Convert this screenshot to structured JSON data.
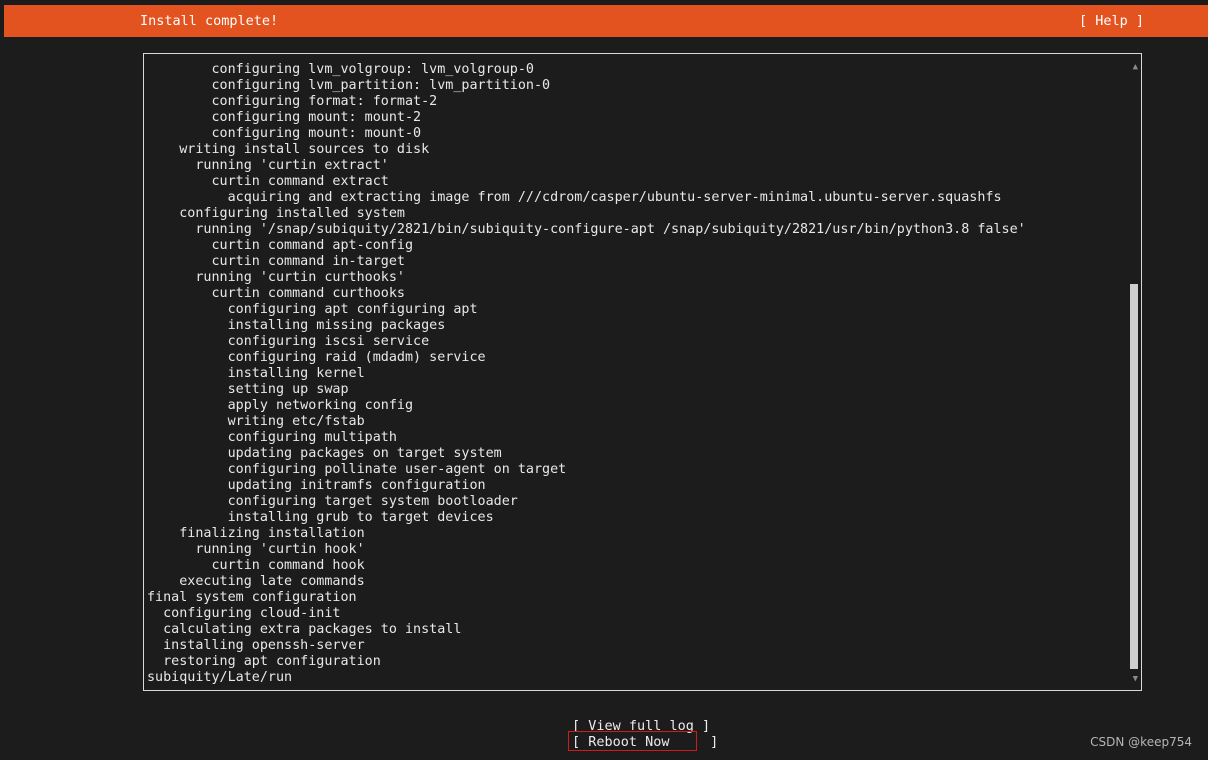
{
  "header": {
    "title": "Install complete!",
    "help_label": "[ Help ]",
    "color": "#e2531f"
  },
  "log": {
    "lines": [
      "        configuring lvm_volgroup: lvm_volgroup-0",
      "        configuring lvm_partition: lvm_partition-0",
      "        configuring format: format-2",
      "        configuring mount: mount-2",
      "        configuring mount: mount-0",
      "    writing install sources to disk",
      "      running 'curtin extract'",
      "        curtin command extract",
      "          acquiring and extracting image from ///cdrom/casper/ubuntu-server-minimal.ubuntu-server.squashfs",
      "    configuring installed system",
      "      running '/snap/subiquity/2821/bin/subiquity-configure-apt /snap/subiquity/2821/usr/bin/python3.8 false'",
      "        curtin command apt-config",
      "        curtin command in-target",
      "      running 'curtin curthooks'",
      "        curtin command curthooks",
      "          configuring apt configuring apt",
      "          installing missing packages",
      "          configuring iscsi service",
      "          configuring raid (mdadm) service",
      "          installing kernel",
      "          setting up swap",
      "          apply networking config",
      "          writing etc/fstab",
      "          configuring multipath",
      "          updating packages on target system",
      "          configuring pollinate user-agent on target",
      "          updating initramfs configuration",
      "          configuring target system bootloader",
      "          installing grub to target devices",
      "    finalizing installation",
      "      running 'curtin hook'",
      "        curtin command hook",
      "    executing late commands",
      "final system configuration",
      "  configuring cloud-init",
      "  calculating extra packages to install",
      "  installing openssh-server",
      "  restoring apt configuration",
      "subiquity/Late/run"
    ]
  },
  "scrollbar": {
    "up_icon": "▲",
    "down_icon": "▼"
  },
  "actions": {
    "view_full_log": "[ View full log ]",
    "reboot_now": "[ Reboot Now     ]"
  },
  "watermark": "CSDN @keep754"
}
